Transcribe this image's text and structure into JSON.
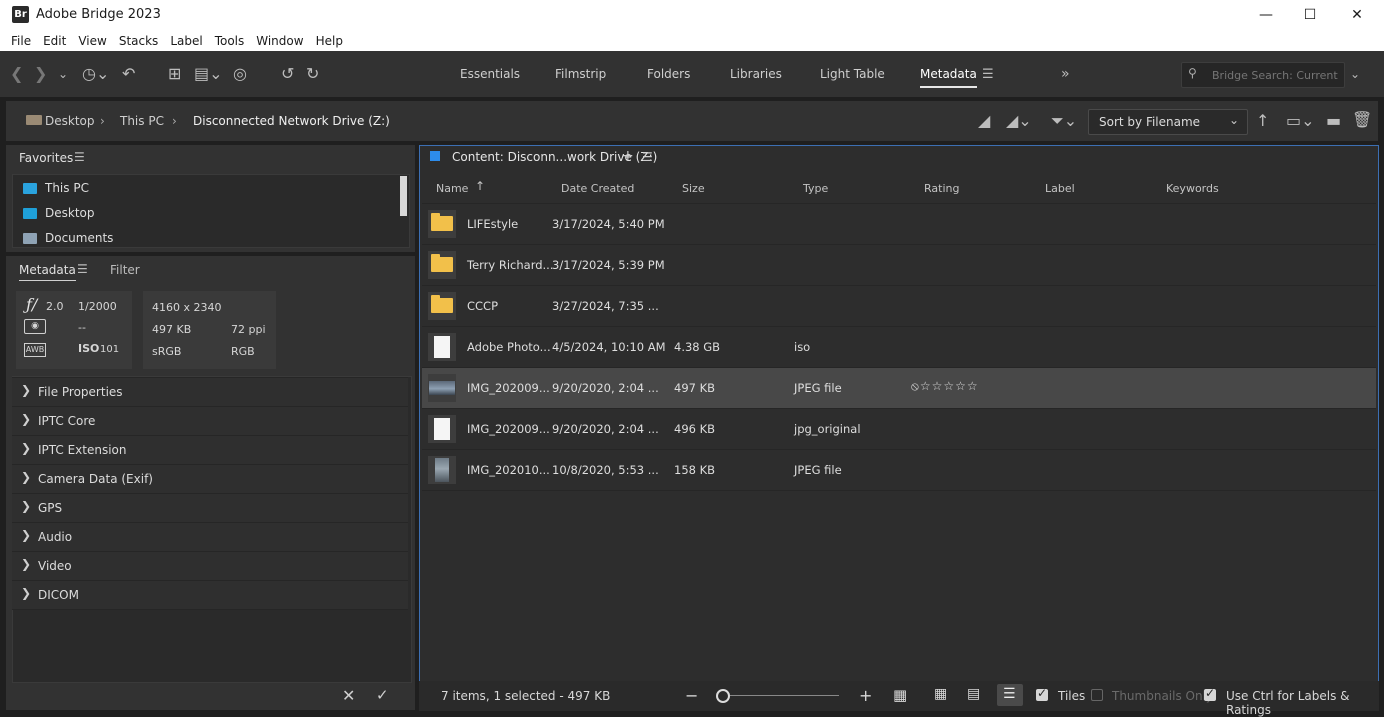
{
  "app": {
    "title": "Adobe Bridge 2023",
    "logo": "Br"
  },
  "menu": [
    "File",
    "Edit",
    "View",
    "Stacks",
    "Label",
    "Tools",
    "Window",
    "Help"
  ],
  "workspaces": [
    "Essentials",
    "Filmstrip",
    "Folders",
    "Libraries",
    "Light Table",
    "Metadata"
  ],
  "active_workspace": "Metadata",
  "search": {
    "placeholder": "Bridge Search: Current"
  },
  "breadcrumb": [
    "Desktop",
    "This PC",
    "Disconnected Network Drive (Z:)"
  ],
  "sort": {
    "label": "Sort by Filename"
  },
  "favorites": {
    "title": "Favorites",
    "items": [
      "This PC",
      "Desktop",
      "Documents"
    ]
  },
  "metadata_panel": {
    "tabs": [
      "Metadata",
      "Filter"
    ],
    "placard": {
      "aperture_symbol": "ƒ/",
      "aperture": "2.0",
      "shutter": "1/2000",
      "metering": "--",
      "wb": "AWB",
      "iso_label": "ISO",
      "iso": "101",
      "dimensions": "4160 x 2340",
      "filesize": "497 KB",
      "resolution": "72 ppi",
      "colorspace": "sRGB",
      "mode": "RGB"
    },
    "sections": [
      "File Properties",
      "IPTC Core",
      "IPTC Extension",
      "Camera Data (Exif)",
      "GPS",
      "Audio",
      "Video",
      "DICOM"
    ]
  },
  "content": {
    "title": "Content: Disconn...work Drive (Z:)",
    "columns": [
      "Name",
      "Date Created",
      "Size",
      "Type",
      "Rating",
      "Label",
      "Keywords"
    ],
    "rows": [
      {
        "name": "LIFEstyle",
        "date": "3/17/2024, 5:40 PM",
        "size": "",
        "type": "",
        "icon": "folder"
      },
      {
        "name": "Terry Richard...",
        "date": "3/17/2024, 5:39 PM",
        "size": "",
        "type": "",
        "icon": "folder"
      },
      {
        "name": "CCCP",
        "date": "3/27/2024, 7:35 ...",
        "size": "",
        "type": "",
        "icon": "folder"
      },
      {
        "name": "Adobe Photo...",
        "date": "4/5/2024, 10:10 AM",
        "size": "4.38 GB",
        "type": "iso",
        "icon": "document"
      },
      {
        "name": "IMG_202009...",
        "date": "9/20/2020, 2:04 ...",
        "size": "497 KB",
        "type": "JPEG file",
        "icon": "photo-landscape",
        "rating": "⦸☆☆☆☆☆"
      },
      {
        "name": "IMG_202009...",
        "date": "9/20/2020, 2:04 ...",
        "size": "496 KB",
        "type": "jpg_original",
        "icon": "document"
      },
      {
        "name": "IMG_202010...",
        "date": "10/8/2020, 5:53 ...",
        "size": "158 KB",
        "type": "JPEG file",
        "icon": "photo-portrait"
      }
    ]
  },
  "status": {
    "summary": "7 items, 1 selected - 497 KB",
    "tiles_label": "Tiles",
    "thumbs_only_label": "Thumbnails Only",
    "ctrl_label": "Use Ctrl for Labels & Ratings"
  }
}
